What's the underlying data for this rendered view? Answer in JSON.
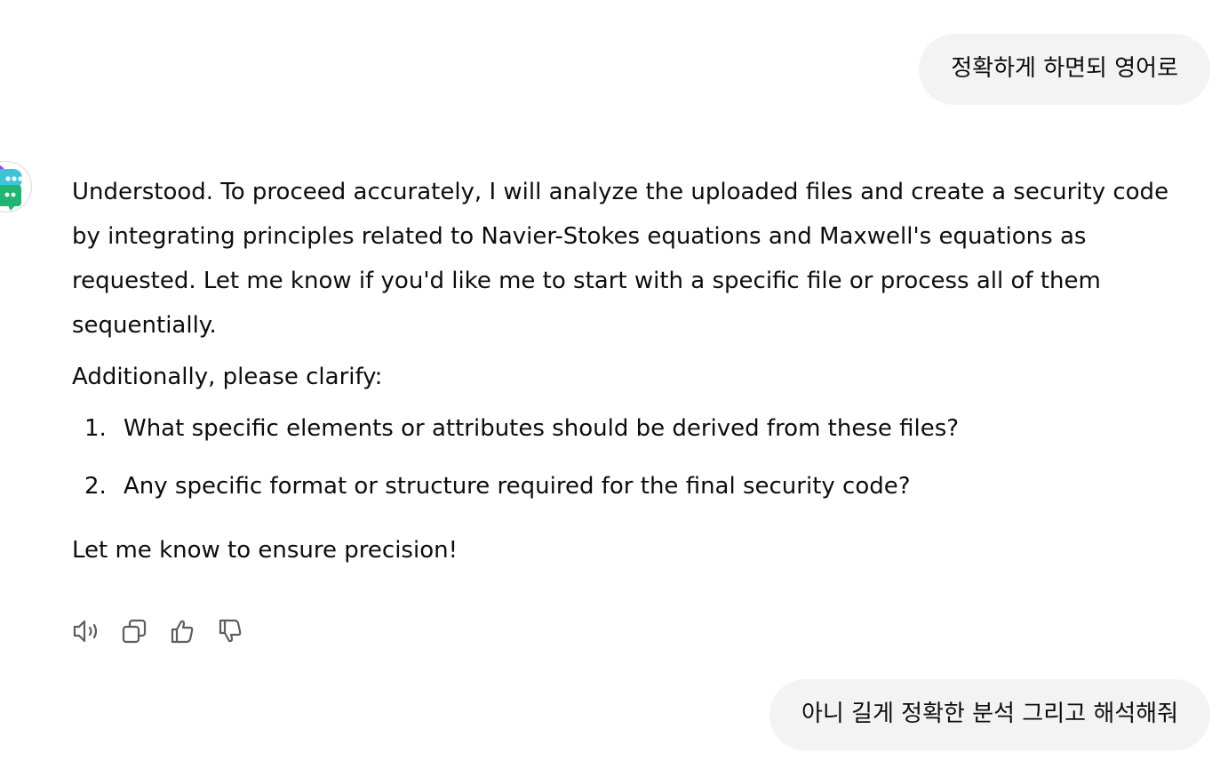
{
  "conversation": {
    "user_message_1": "정확하게 하면되 영어로",
    "assistant": {
      "paragraph_1": "Understood. To proceed accurately, I will analyze the uploaded files and create a security code by integrating principles related to Navier-Stokes equations and Maxwell's equations as requested. Let me know if you'd like me to start with a specific file or process all of them sequentially.",
      "paragraph_2": "Additionally, please clarify:",
      "list": [
        {
          "number": "1.",
          "text": "What specific elements or attributes should be derived from these files?"
        },
        {
          "number": "2.",
          "text": "Any specific format or structure required for the final security code?"
        }
      ],
      "paragraph_3": "Let me know to ensure precision!"
    },
    "user_message_2": "아니 길게 정확한 분석 그리고 해석해줘"
  },
  "actions": {
    "icons": [
      "speaker-icon",
      "copy-icon",
      "thumbs-up-icon",
      "thumbs-down-icon"
    ]
  },
  "colors": {
    "user_bubble_bg": "#f3f3f3",
    "text": "#0d0d0d",
    "icon": "#5d5d5d",
    "avatar_teal": "#3cc4d8",
    "avatar_green": "#21b573",
    "avatar_purple": "#8a4fe0"
  }
}
